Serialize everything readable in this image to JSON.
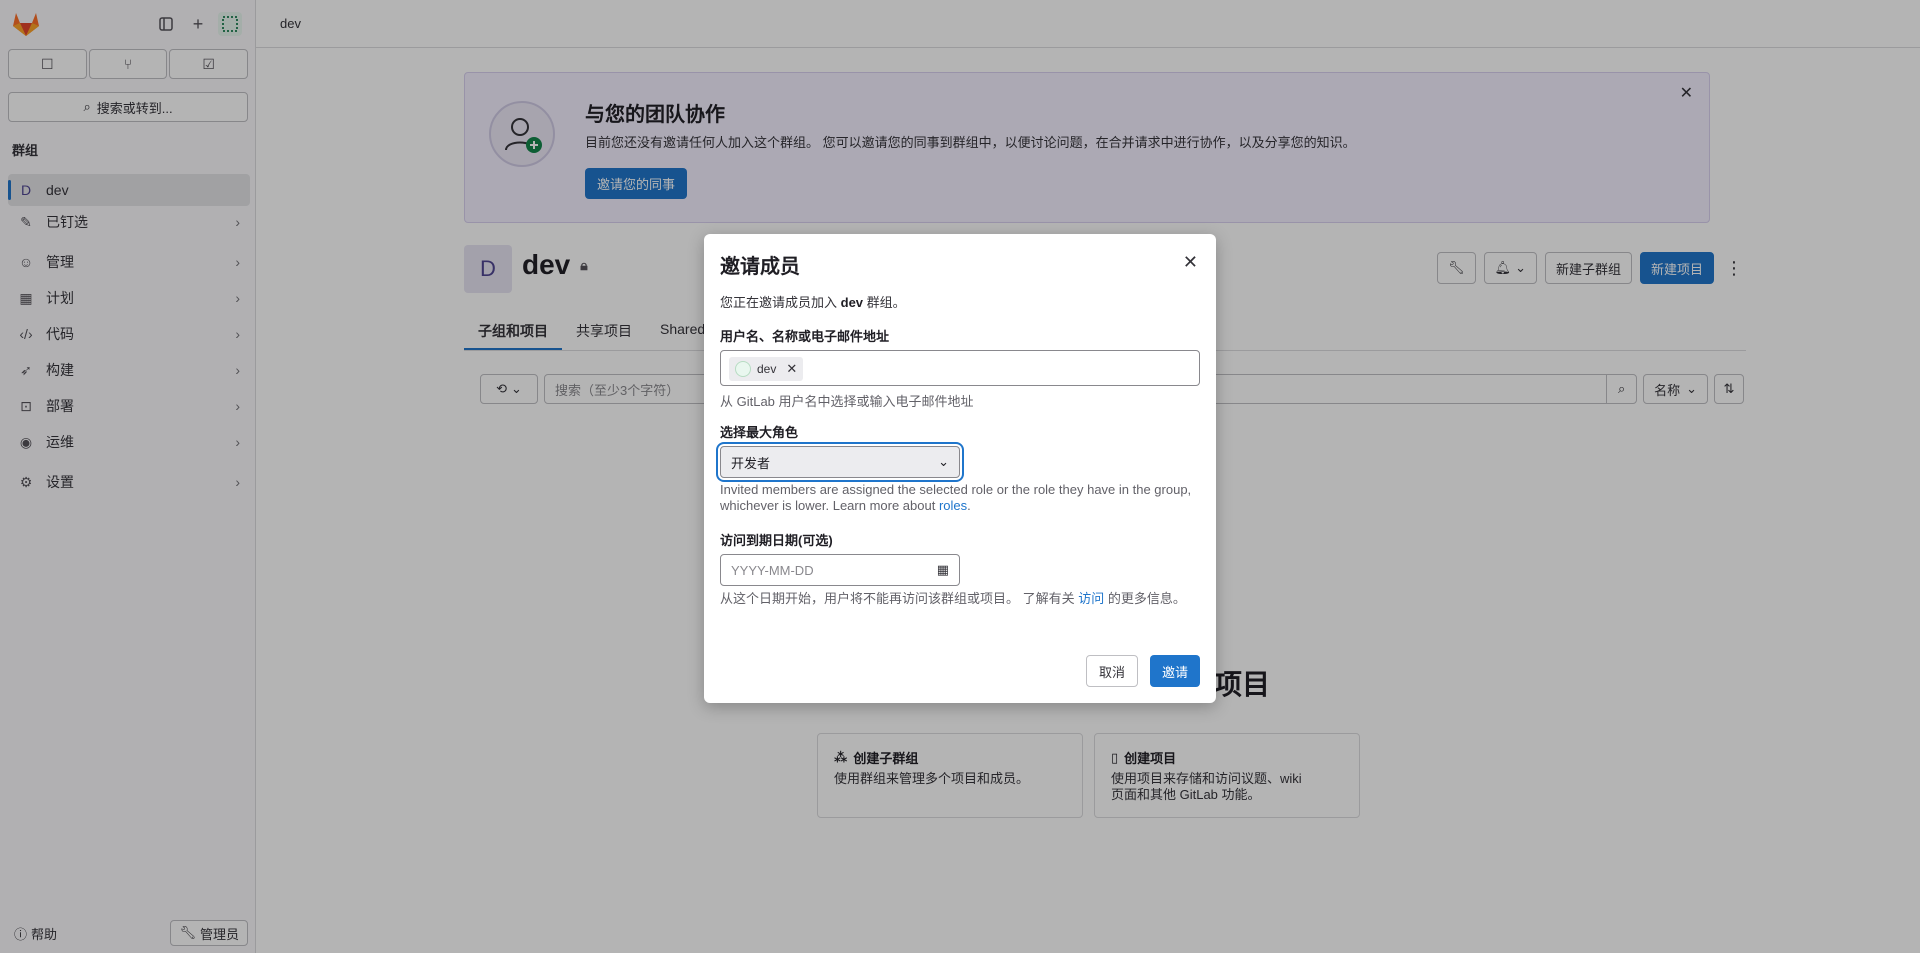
{
  "sidebar": {
    "search_label": "搜索或转到...",
    "section_title": "群组",
    "group_item": {
      "letter": "D",
      "label": "dev"
    },
    "items": [
      {
        "label": "已钉选",
        "icon": "pin-icon"
      },
      {
        "label": "管理",
        "icon": "users-icon"
      },
      {
        "label": "计划",
        "icon": "calendar-icon"
      },
      {
        "label": "代码",
        "icon": "code-icon"
      },
      {
        "label": "构建",
        "icon": "rocket-icon"
      },
      {
        "label": "部署",
        "icon": "deploy-icon"
      },
      {
        "label": "运维",
        "icon": "monitor-icon"
      },
      {
        "label": "设置",
        "icon": "gear-icon"
      }
    ],
    "help_label": "帮助",
    "admin_label": "管理员"
  },
  "breadcrumb": "dev",
  "banner": {
    "title": "与您的团队协作",
    "text": "目前您还没有邀请任何人加入这个群组。 您可以邀请您的同事到群组中，以便讨论问题，在合并请求中进行协作，以及分享您的知识。",
    "button": "邀请您的同事"
  },
  "group": {
    "avatar_letter": "D",
    "name": "dev",
    "new_subgroup": "新建子群组",
    "new_project": "新建项目"
  },
  "tabs": [
    "子组和项目",
    "共享项目",
    "Shared"
  ],
  "filter": {
    "placeholder": "搜索（至少3个字符）",
    "sort_label": "名称"
  },
  "empty_state": {
    "title_fragment": "项目",
    "cards": [
      {
        "title": "创建子群组",
        "desc": "使用群组来管理多个项目和成员。"
      },
      {
        "title": "创建项目",
        "desc": "使用项目来存储和访问议题、wiki 页面和其他 GitLab 功能。"
      }
    ]
  },
  "modal": {
    "title": "邀请成员",
    "intro_prefix": "您正在邀请成员加入 ",
    "intro_group": "dev",
    "intro_suffix": " 群组。",
    "user_label": "用户名、名称或电子邮件地址",
    "token_label": "dev",
    "user_help": "从 GitLab 用户名中选择或输入电子邮件地址",
    "role_label": "选择最大角色",
    "role_value": "开发者",
    "role_note": "Invited members are assigned the selected role or the role they have in the group, whichever is lower. Learn more about ",
    "role_link": "roles",
    "role_note_end": ".",
    "date_label": "访问到期日期(可选)",
    "date_placeholder": "YYYY-MM-DD",
    "date_help_prefix": "从这个日期开始，用户将不能再访问该群组或项目。 了解有关 ",
    "date_help_link": "访问",
    "date_help_suffix": " 的更多信息。",
    "cancel": "取消",
    "invite": "邀请"
  },
  "colors": {
    "accent": "#1f75cb",
    "banner_bg": "#f4f0ff"
  }
}
